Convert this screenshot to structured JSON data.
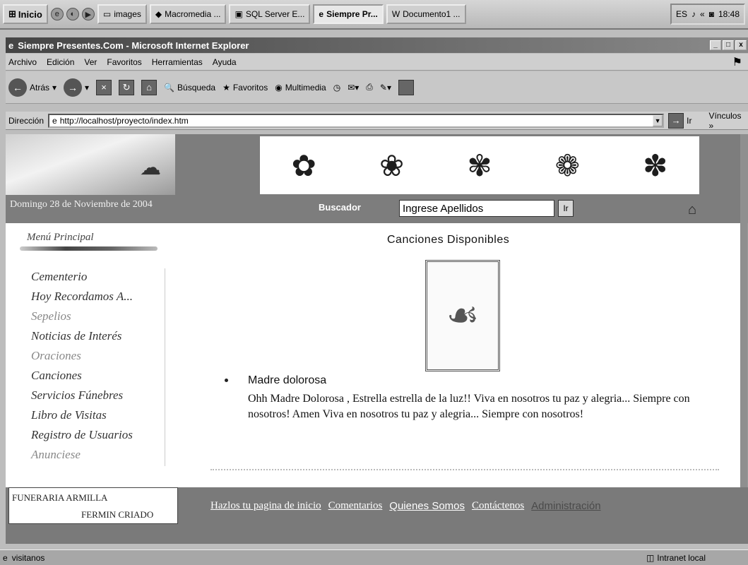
{
  "taskbar": {
    "start_label": "Inicio",
    "buttons": [
      {
        "label": "images"
      },
      {
        "label": "Macromedia ..."
      },
      {
        "label": "SQL Server E..."
      },
      {
        "label": "Siempre Pr..."
      },
      {
        "label": "Documento1 ..."
      }
    ],
    "lang": "ES",
    "time": "18:48"
  },
  "window": {
    "title": "Siempre Presentes.Com - Microsoft Internet Explorer",
    "controls": [
      "_",
      "□",
      "x"
    ]
  },
  "menubar": [
    "Archivo",
    "Edición",
    "Ver",
    "Favoritos",
    "Herramientas",
    "Ayuda"
  ],
  "toolbar": {
    "back": "Atrás",
    "search": "Búsqueda",
    "favorites": "Favoritos",
    "multimedia": "Multimedia"
  },
  "address": {
    "label": "Dirección",
    "url": "http://localhost/proyecto/index.htm",
    "go": "Ir",
    "links": "Vínculos »"
  },
  "banner": {
    "date": "Domingo 28 de Noviembre de 2004",
    "search_label": "Buscador",
    "search_value": "Ingrese Apellidos",
    "search_go": "Ir"
  },
  "menu": {
    "title": "Menú Principal",
    "items": [
      "Cementerio",
      "Hoy Recordamos A...",
      "Sepelios",
      "Noticias de Interés",
      "Oraciones",
      "Canciones",
      "Servicios Fúnebres",
      "Libro de Visitas",
      "Registro de Usuarios",
      "Anunciese"
    ]
  },
  "songs": {
    "title": "Canciones Disponibles",
    "items": [
      {
        "name": "Madre dolorosa",
        "lyrics": "Ohh Madre Dolorosa , Estrella estrella de la luz!! Viva en nosotros tu paz y alegria... Siempre con nosotros! Amen Viva en nosotros tu paz y alegria... Siempre con nosotros!"
      }
    ]
  },
  "footer": {
    "company": "FUNERARIA ARMILLA",
    "person": "FERMIN CRIADO",
    "links": [
      "Hazlos tu pagina de inicio",
      "Comentarios",
      "Quienes Somos",
      "Contáctenos",
      "Administración"
    ]
  },
  "status": {
    "text": "visitanos",
    "zone": "Intranet local"
  }
}
